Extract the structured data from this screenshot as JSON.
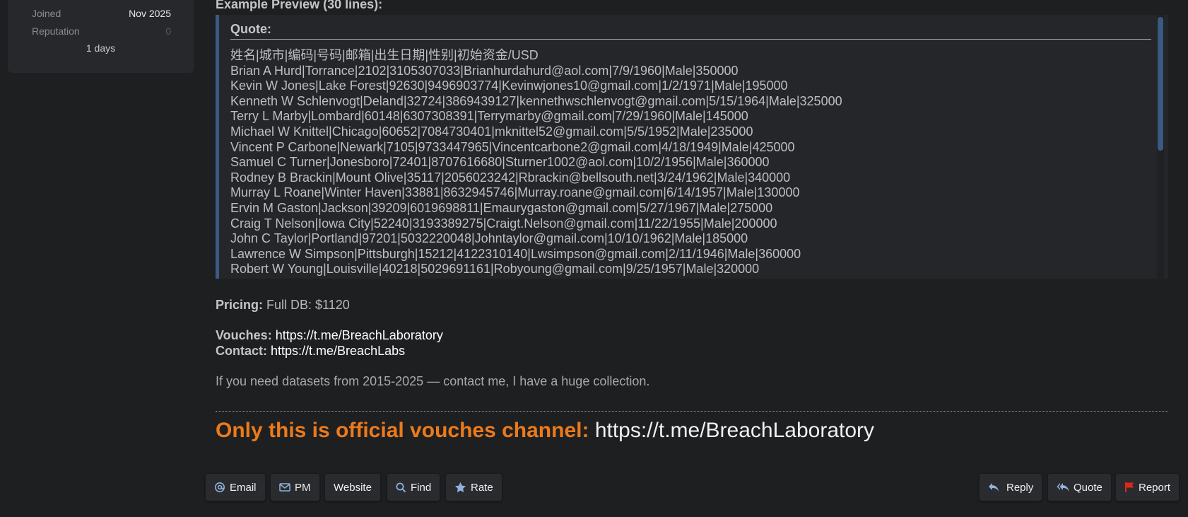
{
  "user_panel": {
    "joined_label": "Joined",
    "joined_value": "Nov 2025",
    "reputation_label": "Reputation",
    "reputation_value": "0",
    "days": "1 days"
  },
  "post": {
    "preview_title": "Example Preview (30 lines):",
    "quote_label": "Quote:",
    "quote_lines": [
      "姓名|城市|编码|号码|邮箱|出生日期|性别|初始资金/USD",
      "Brian A Hurd|Torrance|2102|3105307033|Brianhurdahurd@aol.com|7/9/1960|Male|350000",
      "Kevin W Jones|Lake Forest|92630|9496903774|Kevinwjones10@gmail.com|1/2/1971|Male|195000",
      "Kenneth W Schlenvogt|Deland|32724|3869439127|kennethwschlenvogt@gmail.com|5/15/1964|Male|325000",
      "Terry L Marby|Lombard|60148|6307308391|Terrymarby@gmail.com|7/29/1960|Male|145000",
      "Michael W Knittel|Chicago|60652|7084730401|mknittel52@gmail.com|5/5/1952|Male|235000",
      "Vincent P Carbone|Newark|7105|9733447965|Vincentcarbone2@gmail.com|4/18/1949|Male|425000",
      "Samuel C Turner|Jonesboro|72401|8707616680|Sturner1002@aol.com|10/2/1956|Male|360000",
      "Rodney B Brackin|Mount Olive|35117|2056023242|Rbrackin@bellsouth.net|3/24/1962|Male|340000",
      "Murray L Roane|Winter Haven|33881|8632945746|Murray.roane@gmail.com|6/14/1957|Male|130000",
      "Ervin M Gaston|Jackson|39209|6019698811|Emaurygaston@gmail.com|5/27/1967|Male|275000",
      "Craig T Nelson|Iowa City|52240|3193389275|Craigt.Nelson@gmail.com|11/22/1955|Male|200000",
      "John C Taylor|Portland|97201|5032220048|Johntaylor@gmail.com|10/10/1962|Male|185000",
      "Lawrence W Simpson|Pittsburgh|15212|4122310140|Lwsimpson@gmail.com|2/11/1946|Male|360000",
      "Robert W Young|Louisville|40218|5029691161|Robyoung@gmail.com|9/25/1957|Male|320000"
    ],
    "pricing_label": "Pricing:",
    "pricing_value": "Full DB: $1120",
    "vouches_label": "Vouches:",
    "vouches_link": "https://t.me/BreachLaboratory",
    "contact_label": "Contact:",
    "contact_link": "https://t.me/BreachLabs",
    "note": "If you need datasets from 2015-2025 — contact me, I have a huge collection.",
    "official_label": "Only this is official vouches channel:",
    "official_link": "https://t.me/BreachLaboratory"
  },
  "actions": {
    "email": "Email",
    "pm": "PM",
    "website": "Website",
    "find": "Find",
    "rate": "Rate",
    "reply": "Reply",
    "quote": "Quote",
    "report": "Report"
  },
  "icons": {
    "email": "at-icon",
    "pm": "envelope-icon",
    "find": "search-icon",
    "rate": "star-icon",
    "reply": "reply-arrow-icon",
    "quote": "reply-all-icon",
    "report": "flag-icon"
  },
  "colors": {
    "background": "#1e1f21",
    "accent_orange": "#ec7a1b",
    "quote_border": "#3b5a83",
    "report_flag": "#e0261b",
    "icon_blue": "#8fb3dd"
  }
}
